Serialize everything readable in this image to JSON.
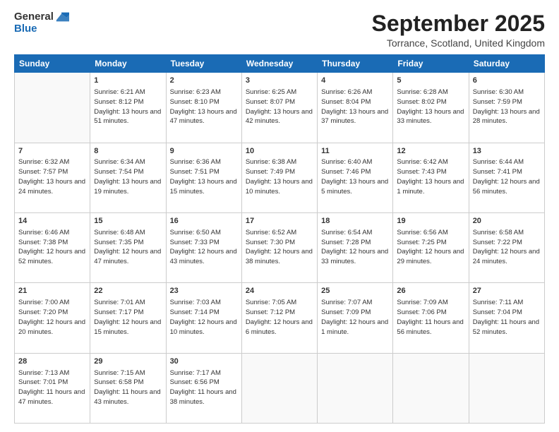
{
  "header": {
    "logo_general": "General",
    "logo_blue": "Blue",
    "month_title": "September 2025",
    "location": "Torrance, Scotland, United Kingdom"
  },
  "weekdays": [
    "Sunday",
    "Monday",
    "Tuesday",
    "Wednesday",
    "Thursday",
    "Friday",
    "Saturday"
  ],
  "weeks": [
    [
      {
        "day": "",
        "sunrise": "",
        "sunset": "",
        "daylight": ""
      },
      {
        "day": "1",
        "sunrise": "Sunrise: 6:21 AM",
        "sunset": "Sunset: 8:12 PM",
        "daylight": "Daylight: 13 hours and 51 minutes."
      },
      {
        "day": "2",
        "sunrise": "Sunrise: 6:23 AM",
        "sunset": "Sunset: 8:10 PM",
        "daylight": "Daylight: 13 hours and 47 minutes."
      },
      {
        "day": "3",
        "sunrise": "Sunrise: 6:25 AM",
        "sunset": "Sunset: 8:07 PM",
        "daylight": "Daylight: 13 hours and 42 minutes."
      },
      {
        "day": "4",
        "sunrise": "Sunrise: 6:26 AM",
        "sunset": "Sunset: 8:04 PM",
        "daylight": "Daylight: 13 hours and 37 minutes."
      },
      {
        "day": "5",
        "sunrise": "Sunrise: 6:28 AM",
        "sunset": "Sunset: 8:02 PM",
        "daylight": "Daylight: 13 hours and 33 minutes."
      },
      {
        "day": "6",
        "sunrise": "Sunrise: 6:30 AM",
        "sunset": "Sunset: 7:59 PM",
        "daylight": "Daylight: 13 hours and 28 minutes."
      }
    ],
    [
      {
        "day": "7",
        "sunrise": "Sunrise: 6:32 AM",
        "sunset": "Sunset: 7:57 PM",
        "daylight": "Daylight: 13 hours and 24 minutes."
      },
      {
        "day": "8",
        "sunrise": "Sunrise: 6:34 AM",
        "sunset": "Sunset: 7:54 PM",
        "daylight": "Daylight: 13 hours and 19 minutes."
      },
      {
        "day": "9",
        "sunrise": "Sunrise: 6:36 AM",
        "sunset": "Sunset: 7:51 PM",
        "daylight": "Daylight: 13 hours and 15 minutes."
      },
      {
        "day": "10",
        "sunrise": "Sunrise: 6:38 AM",
        "sunset": "Sunset: 7:49 PM",
        "daylight": "Daylight: 13 hours and 10 minutes."
      },
      {
        "day": "11",
        "sunrise": "Sunrise: 6:40 AM",
        "sunset": "Sunset: 7:46 PM",
        "daylight": "Daylight: 13 hours and 5 minutes."
      },
      {
        "day": "12",
        "sunrise": "Sunrise: 6:42 AM",
        "sunset": "Sunset: 7:43 PM",
        "daylight": "Daylight: 13 hours and 1 minute."
      },
      {
        "day": "13",
        "sunrise": "Sunrise: 6:44 AM",
        "sunset": "Sunset: 7:41 PM",
        "daylight": "Daylight: 12 hours and 56 minutes."
      }
    ],
    [
      {
        "day": "14",
        "sunrise": "Sunrise: 6:46 AM",
        "sunset": "Sunset: 7:38 PM",
        "daylight": "Daylight: 12 hours and 52 minutes."
      },
      {
        "day": "15",
        "sunrise": "Sunrise: 6:48 AM",
        "sunset": "Sunset: 7:35 PM",
        "daylight": "Daylight: 12 hours and 47 minutes."
      },
      {
        "day": "16",
        "sunrise": "Sunrise: 6:50 AM",
        "sunset": "Sunset: 7:33 PM",
        "daylight": "Daylight: 12 hours and 43 minutes."
      },
      {
        "day": "17",
        "sunrise": "Sunrise: 6:52 AM",
        "sunset": "Sunset: 7:30 PM",
        "daylight": "Daylight: 12 hours and 38 minutes."
      },
      {
        "day": "18",
        "sunrise": "Sunrise: 6:54 AM",
        "sunset": "Sunset: 7:28 PM",
        "daylight": "Daylight: 12 hours and 33 minutes."
      },
      {
        "day": "19",
        "sunrise": "Sunrise: 6:56 AM",
        "sunset": "Sunset: 7:25 PM",
        "daylight": "Daylight: 12 hours and 29 minutes."
      },
      {
        "day": "20",
        "sunrise": "Sunrise: 6:58 AM",
        "sunset": "Sunset: 7:22 PM",
        "daylight": "Daylight: 12 hours and 24 minutes."
      }
    ],
    [
      {
        "day": "21",
        "sunrise": "Sunrise: 7:00 AM",
        "sunset": "Sunset: 7:20 PM",
        "daylight": "Daylight: 12 hours and 20 minutes."
      },
      {
        "day": "22",
        "sunrise": "Sunrise: 7:01 AM",
        "sunset": "Sunset: 7:17 PM",
        "daylight": "Daylight: 12 hours and 15 minutes."
      },
      {
        "day": "23",
        "sunrise": "Sunrise: 7:03 AM",
        "sunset": "Sunset: 7:14 PM",
        "daylight": "Daylight: 12 hours and 10 minutes."
      },
      {
        "day": "24",
        "sunrise": "Sunrise: 7:05 AM",
        "sunset": "Sunset: 7:12 PM",
        "daylight": "Daylight: 12 hours and 6 minutes."
      },
      {
        "day": "25",
        "sunrise": "Sunrise: 7:07 AM",
        "sunset": "Sunset: 7:09 PM",
        "daylight": "Daylight: 12 hours and 1 minute."
      },
      {
        "day": "26",
        "sunrise": "Sunrise: 7:09 AM",
        "sunset": "Sunset: 7:06 PM",
        "daylight": "Daylight: 11 hours and 56 minutes."
      },
      {
        "day": "27",
        "sunrise": "Sunrise: 7:11 AM",
        "sunset": "Sunset: 7:04 PM",
        "daylight": "Daylight: 11 hours and 52 minutes."
      }
    ],
    [
      {
        "day": "28",
        "sunrise": "Sunrise: 7:13 AM",
        "sunset": "Sunset: 7:01 PM",
        "daylight": "Daylight: 11 hours and 47 minutes."
      },
      {
        "day": "29",
        "sunrise": "Sunrise: 7:15 AM",
        "sunset": "Sunset: 6:58 PM",
        "daylight": "Daylight: 11 hours and 43 minutes."
      },
      {
        "day": "30",
        "sunrise": "Sunrise: 7:17 AM",
        "sunset": "Sunset: 6:56 PM",
        "daylight": "Daylight: 11 hours and 38 minutes."
      },
      {
        "day": "",
        "sunrise": "",
        "sunset": "",
        "daylight": ""
      },
      {
        "day": "",
        "sunrise": "",
        "sunset": "",
        "daylight": ""
      },
      {
        "day": "",
        "sunrise": "",
        "sunset": "",
        "daylight": ""
      },
      {
        "day": "",
        "sunrise": "",
        "sunset": "",
        "daylight": ""
      }
    ]
  ]
}
